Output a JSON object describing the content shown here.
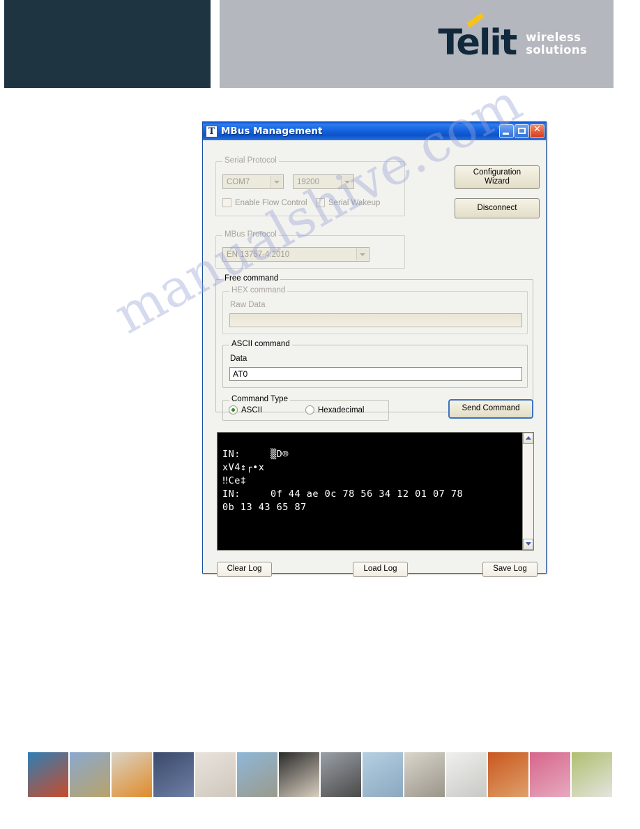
{
  "page": {
    "watermark": "manualshive.com"
  },
  "header": {
    "logo_text": "Telit",
    "tagline_line1": "wireless",
    "tagline_line2": "solutions",
    "navy_color": "#1e3541",
    "gray_color": "#b4b7bd",
    "accent_color": "#f5c31c",
    "logo_color": "#10293c"
  },
  "window": {
    "title": "MBus Management",
    "icon": "telit-t-icon",
    "controls": {
      "minimize": "minimize-icon",
      "maximize": "maximize-icon",
      "close": "close-icon"
    }
  },
  "serial_protocol": {
    "legend": "Serial Protocol",
    "port": "COM7",
    "baudrate": "19200",
    "enable_flow_control": "Enable Flow Control",
    "serial_wakeup": "Serial Wakeup"
  },
  "mbus_protocol": {
    "legend": "MBus Protocol",
    "standard": "EN 13757-4:2010"
  },
  "actions": {
    "configuration_wizard": "Configuration\nWizard",
    "configuration_wizard_line1": "Configuration",
    "configuration_wizard_line2": "Wizard",
    "disconnect": "Disconnect",
    "send_command": "Send Command"
  },
  "free_command": {
    "legend": "Free command",
    "hex": {
      "legend": "HEX command",
      "label": "Raw Data",
      "value": ""
    },
    "ascii": {
      "legend": "ASCII command",
      "label": "Data",
      "value": "AT0"
    },
    "command_type": {
      "legend": "Command Type",
      "options": [
        "ASCII",
        "Hexadecimal"
      ],
      "selected": "ASCII"
    }
  },
  "log": {
    "lines": [
      "IN:     ▒D®",
      "xV4↕┌•x",
      "‼Ce‡",
      "IN:     0f 44 ae 0c 78 56 34 12 01 07 78",
      "0b 13 43 65 87"
    ],
    "text": "IN:     ▒D®\nxV4↕┌•x\n‼Ce‡\nIN:     0f 44 ae 0c 78 56 34 12 01 07 78\n0b 13 43 65 87",
    "scroll_up": "scroll-up-icon",
    "scroll_down": "scroll-down-icon"
  },
  "log_actions": {
    "clear_log": "Clear Log",
    "load_log": "Load Log",
    "save_log": "Save Log"
  },
  "footer": {
    "cells": [
      {
        "name": "airbag-crash-test",
        "c1": "#2f7fb5",
        "c2": "#c84b2a"
      },
      {
        "name": "roadside-phone-sign",
        "c1": "#8aa9cf",
        "c2": "#b9a268"
      },
      {
        "name": "shipping-containers",
        "c1": "#d9d3c6",
        "c2": "#e08b28"
      },
      {
        "name": "digital-clock-display",
        "c1": "#3a4a6b",
        "c2": "#6f7fa5"
      },
      {
        "name": "laptop-keyboard",
        "c1": "#e8e3dc",
        "c2": "#cfc7bd"
      },
      {
        "name": "wheelchair-cyclist",
        "c1": "#8fb7d8",
        "c2": "#9a9a8c"
      },
      {
        "name": "hand-with-card",
        "c1": "#2b2b2b",
        "c2": "#d8cfc0"
      },
      {
        "name": "vending-machine",
        "c1": "#9aa0a8",
        "c2": "#4a4a48"
      },
      {
        "name": "wind-turbines",
        "c1": "#b6cfe2",
        "c2": "#8aa8bf"
      },
      {
        "name": "gas-meter-gauges",
        "c1": "#dad6cc",
        "c2": "#9a958a"
      },
      {
        "name": "window-frame",
        "c1": "#f0f0ee",
        "c2": "#c8c8c4"
      },
      {
        "name": "hands-at-counter",
        "c1": "#c8571f",
        "c2": "#e0a06a"
      },
      {
        "name": "pink-storage-crates",
        "c1": "#d6668c",
        "c2": "#e8a9bf"
      },
      {
        "name": "security-camera",
        "c1": "#aebf6f",
        "c2": "#e4e4de"
      }
    ]
  }
}
